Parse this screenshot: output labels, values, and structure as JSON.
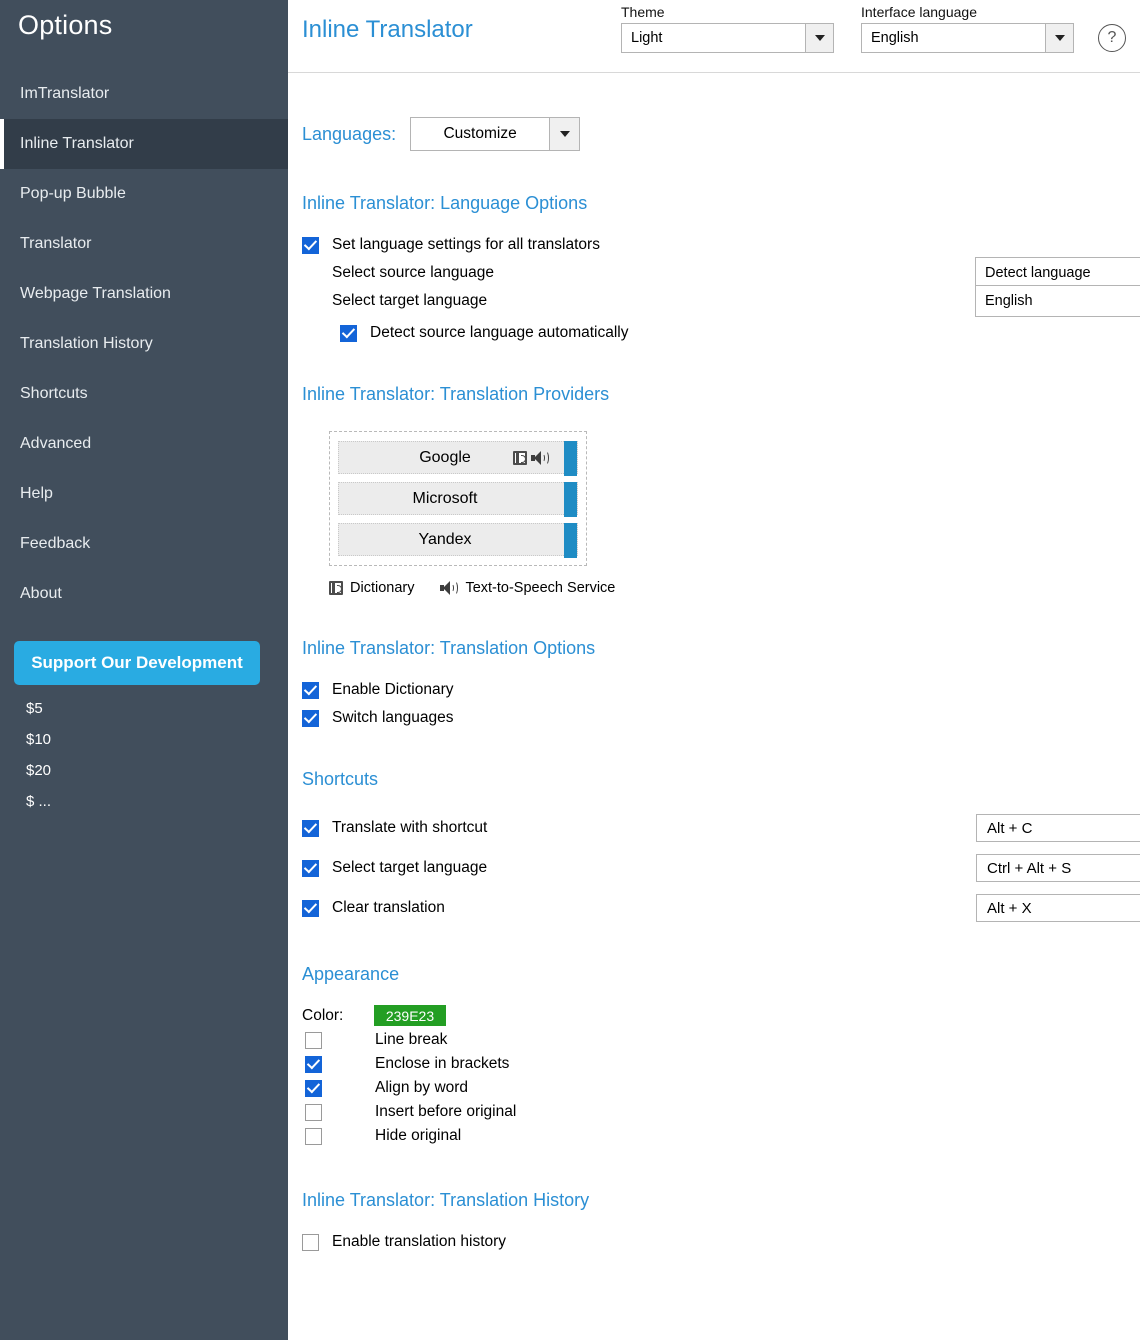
{
  "sidebar": {
    "title": "Options",
    "items": [
      {
        "label": "ImTranslator",
        "active": false
      },
      {
        "label": "Inline Translator",
        "active": true
      },
      {
        "label": "Pop-up Bubble",
        "active": false
      },
      {
        "label": "Translator",
        "active": false
      },
      {
        "label": "Webpage Translation",
        "active": false
      },
      {
        "label": "Translation History",
        "active": false
      },
      {
        "label": "Shortcuts",
        "active": false
      },
      {
        "label": "Advanced",
        "active": false
      },
      {
        "label": "Help",
        "active": false
      },
      {
        "label": "Feedback",
        "active": false
      },
      {
        "label": "About",
        "active": false
      }
    ],
    "support_button": "Support Our Development",
    "donations": [
      "$5",
      "$10",
      "$20",
      "$ ..."
    ],
    "accent_color": "#29abe2",
    "background_color": "#414e5c",
    "active_background_color": "#323d49"
  },
  "header": {
    "title": "Inline Translator",
    "theme": {
      "label": "Theme",
      "value": "Light"
    },
    "interface_language": {
      "label": "Interface language",
      "value": "English"
    },
    "help_icon": "question-mark-icon"
  },
  "languages_bar": {
    "label": "Languages:",
    "customize_value": "Customize"
  },
  "language_options": {
    "section_title": "Inline Translator: Language Options",
    "set_for_all": {
      "label": "Set language settings for all translators",
      "checked": true
    },
    "source": {
      "label": "Select source language",
      "value": "Detect language"
    },
    "target": {
      "label": "Select target language",
      "value": "English"
    },
    "auto_detect": {
      "label": "Detect source language automatically",
      "checked": true
    }
  },
  "providers": {
    "section_title": "Inline Translator: Translation Providers",
    "items": [
      {
        "name": "Google",
        "has_dictionary": true,
        "has_tts": true
      },
      {
        "name": "Microsoft",
        "has_dictionary": false,
        "has_tts": false
      },
      {
        "name": "Yandex",
        "has_dictionary": false,
        "has_tts": false
      }
    ],
    "legend": [
      {
        "icon": "dictionary-icon",
        "label": "Dictionary"
      },
      {
        "icon": "speaker-icon",
        "label": "Text-to-Speech Service"
      }
    ]
  },
  "translation_options": {
    "section_title": "Inline Translator: Translation Options",
    "items": [
      {
        "label": "Enable Dictionary",
        "checked": true
      },
      {
        "label": "Switch languages",
        "checked": true
      }
    ]
  },
  "shortcuts": {
    "section_title": "Shortcuts",
    "items": [
      {
        "label": "Translate with shortcut",
        "checked": true,
        "value": "Alt + C",
        "clearable": true
      },
      {
        "label": "Select target language",
        "checked": true,
        "value": "Ctrl + Alt + S",
        "clearable": false
      },
      {
        "label": "Clear translation",
        "checked": true,
        "value": "Alt + X",
        "clearable": false
      }
    ],
    "clear_icon": "✕"
  },
  "appearance": {
    "section_title": "Appearance",
    "color_label": "Color:",
    "color_value": "239E23",
    "color_hex": "#239E23",
    "items": [
      {
        "label": "Line break",
        "checked": false
      },
      {
        "label": "Enclose in brackets",
        "checked": true
      },
      {
        "label": "Align by word",
        "checked": true
      },
      {
        "label": "Insert before original",
        "checked": false
      },
      {
        "label": "Hide original",
        "checked": false
      }
    ]
  },
  "history": {
    "section_title": "Inline Translator: Translation History",
    "enable": {
      "label": "Enable translation history",
      "checked": false
    }
  }
}
